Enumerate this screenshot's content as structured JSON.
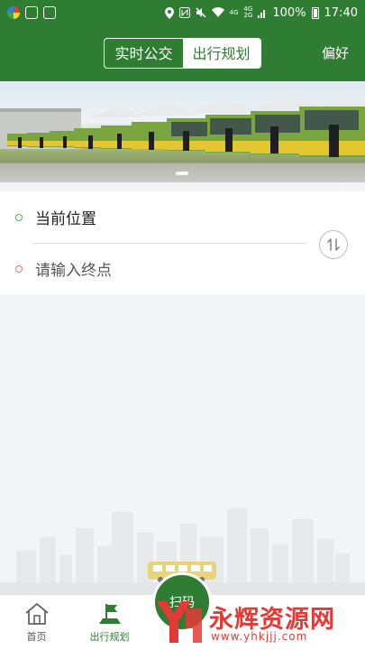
{
  "status_bar": {
    "battery": "100%",
    "time": "17:40",
    "net_a": "4G",
    "net_b": "4G",
    "net_c": "2G"
  },
  "header": {
    "tabs": [
      {
        "label": "实时公交",
        "active": false
      },
      {
        "label": "出行规划",
        "active": true
      }
    ],
    "preference": "偏好"
  },
  "route": {
    "start": "当前位置",
    "end_placeholder": "请输入终点"
  },
  "bottom_nav": {
    "items": [
      {
        "label": "首页",
        "icon": "home-icon",
        "active": false
      },
      {
        "label": "出行规划",
        "icon": "flag-icon",
        "active": true
      }
    ],
    "scan_label": "扫码"
  },
  "watermark": {
    "title": "永辉资源网",
    "url": "www.yhkjjj.com"
  },
  "colors": {
    "brand_green": "#2e7d32",
    "start_dot": "#4caf50",
    "end_dot": "#e57373",
    "watermark_red": "#e53935"
  }
}
